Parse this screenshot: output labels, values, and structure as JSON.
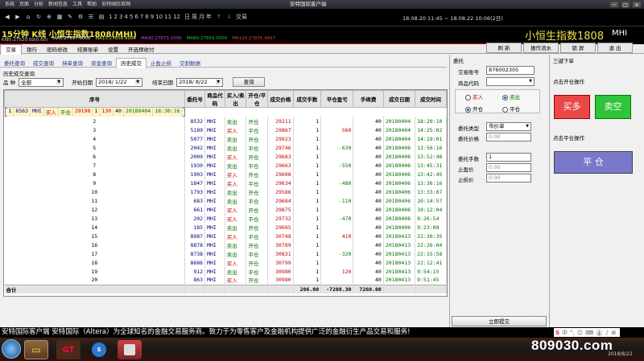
{
  "titlebar": {
    "menu": [
      "系统",
      "页面",
      "分析",
      "新闻信息",
      "工具",
      "帮助",
      "安特国际官网"
    ],
    "title": "安特国际客户端"
  },
  "toolbar": {
    "period_nums": [
      "1",
      "2",
      "3",
      "4",
      "5",
      "6",
      "7",
      "8",
      "9",
      "10",
      "11",
      "12"
    ],
    "periods": [
      "日",
      "周",
      "月",
      "年"
    ],
    "symbols_text": "交易",
    "time_text": "18.08.20 11:45 ~ 18.08.22 10:06(2日)"
  },
  "chartbar": {
    "chart_title": "15分钟 K线 小恒生指数1808(MHI)",
    "ma_labels": [
      {
        "text": "K线5:27520.50(0.60)",
        "color": "#cccccc"
      },
      {
        "text": "MA5:27597.6000",
        "color": "#ffffff"
      },
      {
        "text": "MA10:27658.6000",
        "color": "#f0e04a"
      },
      {
        "text": "MA30:27873.1500",
        "color": "#e040e0"
      },
      {
        "text": "MA60:27859.0000",
        "color": "#30c030"
      },
      {
        "text": "MA120:27835.4667",
        "color": "#e04040"
      }
    ],
    "instrument": "小恒生指数1808",
    "code": "MHI"
  },
  "tabs1": [
    "交易",
    "银行",
    "密码修改",
    "结算账单",
    "设置",
    "开选预收付"
  ],
  "tabs1_active": 0,
  "right_buttons": [
    "刷 新",
    "操作流水",
    "锁 屏",
    "退 出"
  ],
  "tabs2": [
    "委托查询",
    "成交查询",
    "持单查询",
    "资金查询",
    "历史成交",
    "止盈止损",
    "交割数据"
  ],
  "tabs2_active": 4,
  "history": {
    "title": "历史成交查询",
    "product_label": "品 种",
    "product_value": "全部",
    "start_label": "开始日期",
    "start_value": "2018/ 1/22",
    "end_label": "结束日期",
    "end_value": "2018/ 8/22",
    "query_button": "查询"
  },
  "table": {
    "headers": [
      "序号",
      "委托号",
      "商品代码",
      "买入/卖出",
      "开仓/平仓",
      "成交价格",
      "成交手数",
      "平仓盈亏",
      "手续费",
      "成交日期",
      "成交时间"
    ],
    "rows": [
      [
        "1",
        "8563",
        "MHI",
        "买入",
        "平仓",
        "29198",
        "1",
        "130",
        "40",
        "20180404",
        "18:30:16"
      ],
      [
        "2",
        "8532",
        "MHI",
        "卖出",
        "开仓",
        "29211",
        "1",
        "",
        "40",
        "20180404",
        "18:20:10"
      ],
      [
        "3",
        "5189",
        "MHI",
        "买入",
        "平仓",
        "29867",
        "1",
        "560",
        "40",
        "20180404",
        "14:25:02"
      ],
      [
        "4",
        "5077",
        "MHI",
        "卖出",
        "开仓",
        "29923",
        "1",
        "",
        "40",
        "20180404",
        "14:19:01"
      ],
      [
        "5",
        "2042",
        "MHI",
        "卖出",
        "平仓",
        "29746",
        "1",
        "-630",
        "40",
        "20180406",
        "13:56:16"
      ],
      [
        "6",
        "2009",
        "MHI",
        "买入",
        "开仓",
        "29683",
        "1",
        "",
        "40",
        "20180406",
        "13:52:48"
      ],
      [
        "7",
        "1930",
        "MHI",
        "卖出",
        "平仓",
        "29663",
        "1",
        "-550",
        "40",
        "20180406",
        "13:45:31"
      ],
      [
        "8",
        "1903",
        "MHI",
        "买入",
        "开仓",
        "29608",
        "1",
        "",
        "40",
        "20180406",
        "13:42:45"
      ],
      [
        "9",
        "1847",
        "MHI",
        "买入",
        "平仓",
        "29634",
        "1",
        "-480",
        "40",
        "20180406",
        "13:36:16"
      ],
      [
        "10",
        "1793",
        "MHI",
        "卖出",
        "开仓",
        "29586",
        "1",
        "",
        "40",
        "20180406",
        "13:33:07"
      ],
      [
        "11",
        "683",
        "MHI",
        "卖出",
        "平仓",
        "29684",
        "1",
        "-110",
        "40",
        "20180406",
        "10:14:57"
      ],
      [
        "12",
        "661",
        "MHI",
        "买入",
        "开仓",
        "29875",
        "1",
        "",
        "40",
        "20180406",
        "10:12:04"
      ],
      [
        "13",
        "202",
        "MHI",
        "买入",
        "平仓",
        "29732",
        "1",
        "-470",
        "40",
        "20180406",
        "9:26:54"
      ],
      [
        "14",
        "185",
        "MHI",
        "卖出",
        "开仓",
        "29685",
        "1",
        "",
        "40",
        "20180406",
        "9:23:08"
      ],
      [
        "15",
        "8987",
        "MHI",
        "买入",
        "平仓",
        "30748",
        "1",
        "410",
        "40",
        "20180413",
        "22:30:35"
      ],
      [
        "16",
        "8878",
        "MHI",
        "卖出",
        "开仓",
        "30789",
        "1",
        "",
        "40",
        "20180413",
        "22:26:04"
      ],
      [
        "17",
        "8738",
        "MHI",
        "卖出",
        "平仓",
        "30831",
        "1",
        "-320",
        "40",
        "20180413",
        "22:15:58"
      ],
      [
        "18",
        "8686",
        "MHI",
        "买入",
        "开仓",
        "30799",
        "1",
        "",
        "40",
        "20180413",
        "22:12:41"
      ],
      [
        "19",
        "912",
        "MHI",
        "卖出",
        "平仓",
        "30980",
        "1",
        "120",
        "40",
        "20180413",
        "9:54:15"
      ],
      [
        "20",
        "863",
        "MHI",
        "买入",
        "开仓",
        "30980",
        "1",
        "",
        "40",
        "20180413",
        "9:51:45"
      ]
    ],
    "footer": {
      "label": "合计",
      "volume": "206.00",
      "pnl": "-7208.30",
      "fee": "7260.00"
    }
  },
  "order": {
    "title": "委托",
    "account_label": "交易账号",
    "account_value": "876002305",
    "product_label": "商品代码",
    "buy_label": "买入",
    "sell_label": "卖出",
    "open_label": "开仓",
    "close_label": "平仓",
    "type_label": "委托类型",
    "type_value": "市价单",
    "price_label": "委托价格",
    "price_value": "0.00",
    "qty_label": "委托手数",
    "qty_value": "1",
    "sl_label": "止盈价",
    "sl_value": "0.00",
    "tp_label": "止损价",
    "tp_value": "0.00",
    "submit": "立即提交"
  },
  "quick": {
    "title": "三键下单",
    "open_hint": "点击开仓操作",
    "buy": "买多",
    "sell": "卖空",
    "close_hint": "点击平仓操作",
    "close": "平 仓"
  },
  "ticker": {
    "text": "安特国际客户端 安特国际（Altera）为全球知名的金融交易服务商。致力于为零售客户及金融机构提供广泛的金融衍生产品交易和服务!"
  },
  "ime": [
    "中",
    "°,",
    "☺",
    "⌨",
    "👔",
    "♪",
    "⊞"
  ],
  "watermark": "809030.com",
  "clock": "2018/8/22",
  "colors": {
    "buy": "#c00000",
    "sell": "#007000",
    "highlight": "#fff3c8"
  }
}
